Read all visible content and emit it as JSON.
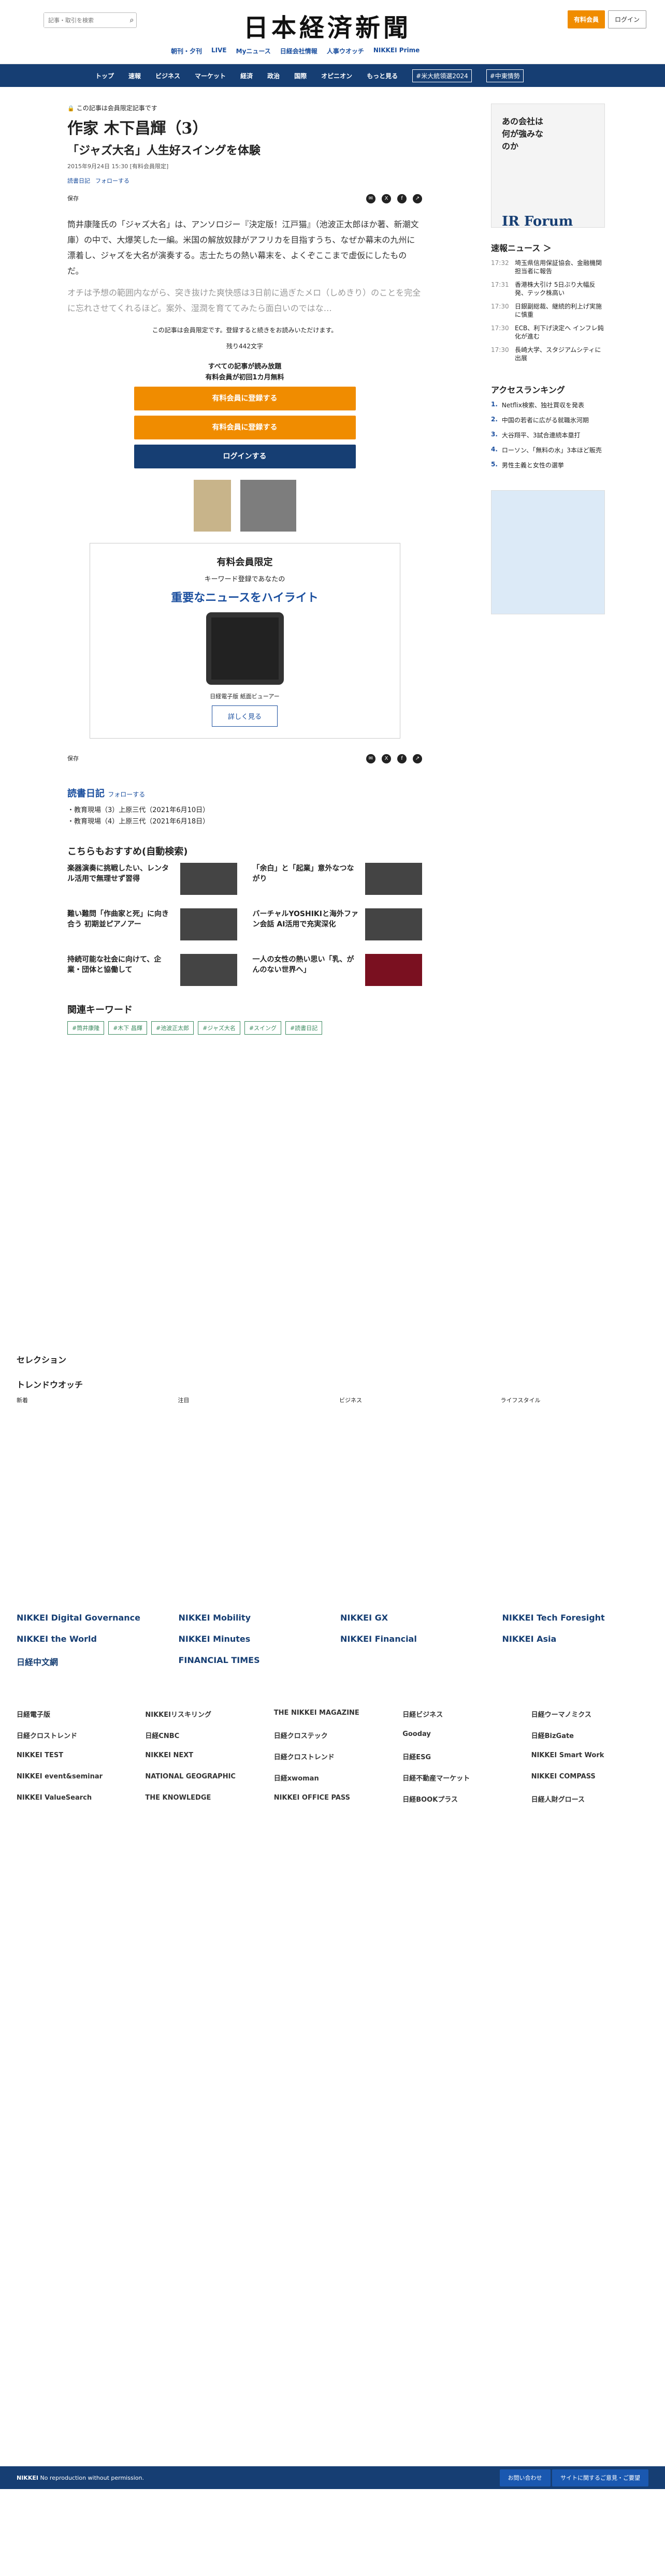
{
  "header": {
    "search_placeholder": "記事・取引を検索",
    "logo": "日本経済新聞",
    "subscribe": "有料会員",
    "login": "ログイン",
    "subnav": [
      "朝刊・夕刊",
      "LIVE",
      "Myニュース",
      "日経会社情報",
      "人事ウオッチ",
      "NIKKEI Prime"
    ],
    "nav": [
      "トップ",
      "速報",
      "ビジネス",
      "マーケット",
      "経済",
      "政治",
      "国際",
      "オピニオン",
      "もっと見る",
      "#米大統領選2024",
      "#中東情勢"
    ]
  },
  "article": {
    "badge": "この記事は会員限定記事です",
    "title": "作家 木下昌輝（3）",
    "subtitle": "「ジャズ大名」人生好スイングを体験",
    "date": "2015年9月24日 15:30 [有料会員限定]",
    "series": "読書日記",
    "follow": "フォローする",
    "save": "保存",
    "p1": "筒井康隆氏の「ジャズ大名」は、アンソロジー『決定版！江戸猫』（池波正太郎ほか著、新潮文庫）の中で、大爆笑した一編。米国の解放奴隷がアフリカを目指すうち、なぜか幕末の九州に漂着し、ジャズを大名が演奏する。志士たちの熱い幕末を、よくぞここまで虚仮にしたものだ。",
    "p2": "オチは予想の範囲内ながら、突き抜けた爽快感は3日前に過ぎたメロ（しめきり）のことを完全に忘れさせてくれるほど。案外、湿潤を育ててみたら面白いのではな…",
    "locked_note": "この記事は会員限定です。登録すると続きをお読みいただけます。",
    "remaining": "残り442文字",
    "readall": "すべての記事が読み放題",
    "trial": "有料会員が初回1カ月無料",
    "cta1": "有料会員に登録する",
    "cta2": "有料会員に登録する",
    "cta3": "ログインする"
  },
  "promo": {
    "title": "有料会員限定",
    "sub": "キーワード登録であなたの",
    "highlight": "重要なニュースをハイライト",
    "caption": "日経電子版 紙面ビューアー",
    "more": "詳しく見る"
  },
  "related": {
    "label": "読書日記",
    "follow": "フォローする",
    "items": [
      "・教育現場（3）上原三代（2021年6月10日）",
      "・教育現場（4）上原三代（2021年6月18日）"
    ]
  },
  "recommend": {
    "title": "こちらもおすすめ(自動検索)",
    "cards": [
      "楽器演奏に挑戦したい、レンタル活用で無理せず習得",
      "「余白」と「起業」意外なつながり",
      "難い難問「作曲家と死」に向き合う 初期並ピアノアー",
      "バーチャルYOSHIKIと海外ファン会話 AI活用で充実深化",
      "持続可能な社会に向けて、企業・団体と協働して",
      "一人の女性の熱い思い「乳、がんのない世界へ」"
    ]
  },
  "keywords": {
    "title": "関連キーワード",
    "items": [
      "#筒井康隆",
      "#木下 昌輝",
      "#池波正太郎",
      "#ジャズ大名",
      "#スイング",
      "#読書日記"
    ]
  },
  "sidebar": {
    "ad_title": "あの会社は何が強みなのか",
    "ad_brand": "IR Forum",
    "news_title": "速報ニュース ＞",
    "news": [
      {
        "t": "17:32",
        "s": "埼玉県信用保証協会、金融機関担当者に報告"
      },
      {
        "t": "17:31",
        "s": "香港株大引け 5日ぶり大幅反発、テック株高い"
      },
      {
        "t": "17:30",
        "s": "日銀副総裁、継続的利上げ実施に慎重"
      },
      {
        "t": "17:30",
        "s": "ECB、利下げ決定へ インフレ鈍化が進む"
      },
      {
        "t": "17:30",
        "s": "長崎大学、スタジアムシティに出展"
      }
    ],
    "rank_title": "アクセスランキング",
    "rank": [
      "Netflix検索、独社買収を発表",
      "中国の若者に広がる就職氷河期",
      "大谷翔平、3試合連続本塁打",
      "ローソン、「無料の水」3本ほど販売",
      "男性主義と女性の選挙"
    ]
  },
  "footer": {
    "selection": "セレクション",
    "trend": "トレンドウオッチ",
    "cols": [
      "新着",
      "注目",
      "ビジネス",
      "ライフスタイル"
    ],
    "brands": [
      "NIKKEI Digital Governance",
      "NIKKEI Mobility",
      "NIKKEI GX",
      "NIKKEI Tech Foresight",
      "NIKKEI the World",
      "NIKKEI Minutes",
      "NIKKEI Financial",
      "NIKKEI Asia",
      "日経中文網",
      "FINANCIAL TIMES"
    ],
    "sites": [
      "日経電子版",
      "NIKKEIリスキリング",
      "THE NIKKEI MAGAZINE",
      "日経ビジネス",
      "日経ウーマノミクス",
      "日経クロストレンド",
      "日経CNBC",
      "日経クロステック",
      "Gooday",
      "日経BizGate",
      "NIKKEI TEST",
      "NIKKEI NEXT",
      "日経クロストレンド",
      "日経ESG",
      "NIKKEI Smart Work",
      "NIKKEI event&seminar",
      "NATIONAL GEOGRAPHIC",
      "日経xwoman",
      "日経不動産マーケット",
      "NIKKEI COMPASS",
      "NIKKEI ValueSearch",
      "THE KNOWLEDGE",
      "NIKKEI OFFICE PASS",
      "日経BOOKプラス",
      "日経人財グロース"
    ],
    "copyright": "No reproduction without permission.",
    "contact": "お問い合わせ",
    "feedback": "サイトに関するご意見・ご要望"
  }
}
